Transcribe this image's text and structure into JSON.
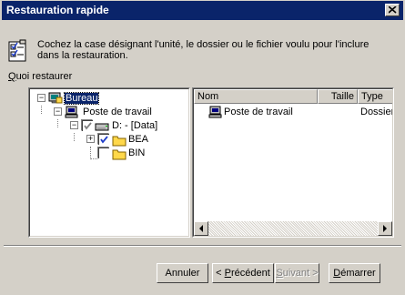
{
  "window": {
    "title": "Restauration rapide"
  },
  "instructions": "Cochez la case désignant l'unité, le dossier ou le fichier voulu pour l'inclure dans la restauration.",
  "what_label": {
    "mnemonic": "Q",
    "rest": "uoi restaurer"
  },
  "tree": {
    "nodes": [
      {
        "label": "Bureau",
        "checkbox": "none",
        "expander": "minus",
        "icon": "desktop-icon",
        "selected": true
      },
      {
        "label": "Poste de travail",
        "checkbox": "none",
        "expander": "minus",
        "icon": "computer-icon",
        "selected": false
      },
      {
        "label": "D: - [Data]",
        "checkbox": "checked-gray",
        "expander": "minus",
        "icon": "drive-icon",
        "selected": false
      },
      {
        "label": "BEA",
        "checkbox": "checked",
        "expander": "plus",
        "icon": "folder-icon",
        "selected": false
      },
      {
        "label": "BIN",
        "checkbox": "unchecked",
        "expander": "none",
        "icon": "folder-icon",
        "selected": false
      }
    ]
  },
  "list": {
    "columns": [
      "Nom",
      "Taille",
      "Type"
    ],
    "rows": [
      {
        "name": "Poste de travail",
        "size": "",
        "type": "Dossier",
        "icon": "computer-icon"
      }
    ]
  },
  "buttons": {
    "cancel": "Annuler",
    "previous": {
      "prefix": "< ",
      "mnemonic": "P",
      "rest": "récédent"
    },
    "next": {
      "mnemonic": "S",
      "rest": "uivant >",
      "enabled": false
    },
    "start": {
      "mnemonic": "D",
      "rest": "émarrer"
    }
  },
  "colors": {
    "title_bar": "#0a246a",
    "face": "#d4d0c8",
    "selection": "#0a246a",
    "check": "#1e3cc8"
  }
}
